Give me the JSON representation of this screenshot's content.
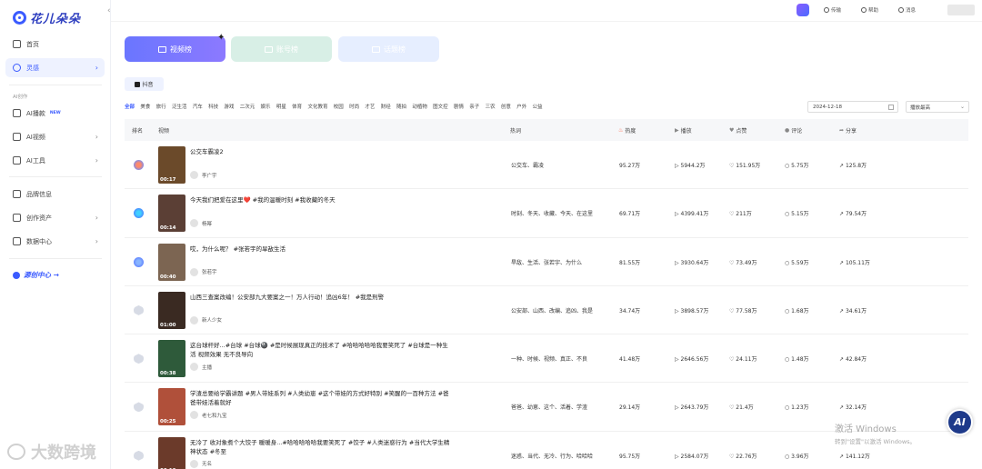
{
  "brand": {
    "name": "花儿朵朵"
  },
  "sidebar": {
    "collapse_icon": "‹",
    "items": [
      {
        "label": "首页",
        "icon": "home-icon"
      },
      {
        "label": "灵感",
        "icon": "bulb-icon",
        "active": true
      },
      {
        "label": "AI播款",
        "icon": "ai-speak-icon",
        "badge": "NEW"
      },
      {
        "label": "AI视频",
        "icon": "video-icon"
      },
      {
        "label": "AI工具",
        "icon": "tool-icon"
      },
      {
        "label": "品牌信息",
        "icon": "brand-icon"
      },
      {
        "label": "创作资产",
        "icon": "asset-icon"
      },
      {
        "label": "数据中心",
        "icon": "data-icon"
      }
    ],
    "section_label": "AI创作",
    "promo": "源创中心 →"
  },
  "topbar": {
    "items": [
      {
        "label": "传输",
        "icon": "transfer-icon"
      },
      {
        "label": "帮助",
        "icon": "help-icon"
      },
      {
        "label": "消息",
        "icon": "message-icon"
      }
    ]
  },
  "ranking_tabs": [
    {
      "label": "视频榜",
      "active": true
    },
    {
      "label": "账号榜"
    },
    {
      "label": "话题榜"
    }
  ],
  "platform_tab": "抖音",
  "categories": [
    "全部",
    "美食",
    "旅行",
    "泛生活",
    "汽车",
    "科技",
    "游戏",
    "二次元",
    "娱乐",
    "明星",
    "体育",
    "文化教育",
    "校园",
    "时尚",
    "才艺",
    "财经",
    "随拍",
    "动植物",
    "图文控",
    "剧情",
    "亲子",
    "三农",
    "创意",
    "户外",
    "公益"
  ],
  "filters": {
    "date": "2024-12-18",
    "sort": "播放最高"
  },
  "table": {
    "headers": {
      "rank": "排名",
      "video": "视频",
      "hotwords": "热词",
      "heat": "热度",
      "plays": "播放",
      "likes": "点赞",
      "comments": "评论",
      "shares": "分享"
    },
    "rows": [
      {
        "rank_style": "r1",
        "duration": "00:17",
        "title": "公交车霸凌2",
        "author": "李广宇",
        "hotwords": "公交车、霸凌",
        "heat": "95.27万",
        "plays": "5944.2万",
        "likes": "151.95万",
        "comments": "5.75万",
        "shares": "125.8万",
        "thumb": "#6b4a2a"
      },
      {
        "rank_style": "r2",
        "duration": "00:14",
        "title": "今天我们把爱在这里❤️ #我的温暖时刻 #我收藏的冬天",
        "author": "杨幂",
        "hotwords": "时刻、冬天、收藏、今天、在这里",
        "heat": "69.71万",
        "plays": "4399.41万",
        "likes": "211万",
        "comments": "5.15万",
        "shares": "79.54万",
        "thumb": "#5b3f35"
      },
      {
        "rank_style": "r3",
        "duration": "00:40",
        "title": "哎，为什么呢？ #张若宇的旱敌生活",
        "author": "张若宇",
        "hotwords": "旱敌、生活、张若宇、为什么",
        "heat": "81.55万",
        "plays": "3930.64万",
        "likes": "73.49万",
        "comments": "5.59万",
        "shares": "105.11万",
        "thumb": "#7c6552"
      },
      {
        "rank_style": "rn",
        "duration": "01:00",
        "title": "山西三查案改编！公安部九大要案之一！万人行动！追凶6年！ #我是刑警",
        "author": "新人少女",
        "hotwords": "公安部、山西、改编、追凶、我是",
        "heat": "34.74万",
        "plays": "3898.57万",
        "likes": "77.58万",
        "comments": "1.68万",
        "shares": "34.61万",
        "thumb": "#3a2a22"
      },
      {
        "rank_style": "rn",
        "duration": "00:38",
        "title": "这台球杆好...#台球 #台球🎱 #是时候展现真正的技术了 #哈哈哈哈哈我要笑死了 #台球是一种生活 视频效果 无不良导向",
        "author": "主播",
        "hotwords": "一种、时候、视频、真正、不良",
        "heat": "41.48万",
        "plays": "2646.56万",
        "likes": "24.11万",
        "comments": "1.48万",
        "shares": "42.84万",
        "thumb": "#2e5a3a"
      },
      {
        "rank_style": "rn",
        "duration": "00:25",
        "title": "学渣总要给学霸讲题 #男人带娃系列 #人类幼崽 #这个带娃的方式好特别 #笑醒的一百种方法 #爸爸带娃活着就好",
        "author": "老七和九宝",
        "hotwords": "爸爸、幼崽、这个、活着、学渣",
        "heat": "29.14万",
        "plays": "2643.79万",
        "likes": "21.4万",
        "comments": "1.23万",
        "shares": "32.14万",
        "thumb": "#b0503a"
      },
      {
        "rank_style": "rn",
        "duration": "00:10",
        "title": "无冷了 收对象煮个大饺子 暖暖身...#哈哈哈哈哈我要笑死了 #饺子 #人类迷惑行为 #当代大学生精神状态 #冬至",
        "author": "无名",
        "hotwords": "迷惑、当代、无冷、行为、哈哈哈",
        "heat": "95.75万",
        "plays": "2584.07万",
        "likes": "22.76万",
        "comments": "3.96万",
        "shares": "141.12万",
        "thumb": "#6b3a2a"
      }
    ]
  },
  "ai_button": "AI",
  "windows_activation": {
    "line1": "激活 Windows",
    "line2": "转到\"设置\"以激活 Windows。"
  },
  "watermark": "大数跨境",
  "colors": {
    "accent": "#3b5bff",
    "tab_video": "#6a76ff",
    "tab_account": "#d8efe6",
    "tab_topic": "#e6eeff"
  }
}
